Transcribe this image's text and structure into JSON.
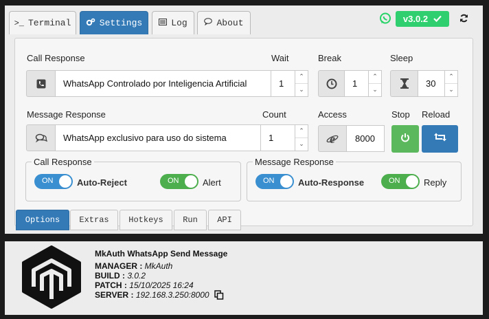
{
  "tabs": [
    {
      "label": "Terminal",
      "icon": "terminal-icon"
    },
    {
      "label": "Settings",
      "icon": "cogs-icon"
    },
    {
      "label": "Log",
      "icon": "list-icon"
    },
    {
      "label": "About",
      "icon": "comment-icon"
    }
  ],
  "header": {
    "version": "v3.0.2",
    "status_icon": "whatsapp-icon",
    "refresh_icon": "refresh-icon"
  },
  "call": {
    "label": "Call Response",
    "value": "WhatsApp Controlado por Inteligencia Artificial",
    "icon": "phone-icon"
  },
  "wait": {
    "label": "Wait",
    "value": "1"
  },
  "break": {
    "label": "Break",
    "value": "1",
    "icon": "clock-icon"
  },
  "sleep": {
    "label": "Sleep",
    "value": "30",
    "icon": "hourglass-icon"
  },
  "message": {
    "label": "Message Response",
    "value": "WhatsApp exclusivo para uso do sistema",
    "icon": "comments-icon"
  },
  "count": {
    "label": "Count",
    "value": "1"
  },
  "access": {
    "label": "Access",
    "value": "8000",
    "icon": "ie-icon"
  },
  "stop": {
    "label": "Stop",
    "icon": "power-icon"
  },
  "reload": {
    "label": "Reload",
    "icon": "retweet-icon"
  },
  "call_group": {
    "title": "Call Response",
    "toggle1": {
      "state": "ON",
      "label": "Auto-Reject"
    },
    "toggle2": {
      "state": "ON",
      "label": "Alert"
    }
  },
  "msg_group": {
    "title": "Message Response",
    "toggle1": {
      "state": "ON",
      "label": "Auto-Response"
    },
    "toggle2": {
      "state": "ON",
      "label": "Reply"
    }
  },
  "bottom_tabs": [
    "Options",
    "Extras",
    "Hotkeys",
    "Run",
    "API"
  ],
  "colors": {
    "primary": "#337ab7",
    "success": "#5cb85c",
    "whatsapp": "#25d366",
    "version_bg": "#2fcf6f"
  },
  "about": {
    "title": "MkAuth WhatsApp Send Message",
    "manager_label": "MANAGER :",
    "manager": "MkAuth",
    "build_label": "BUILD :",
    "build": "3.0.2",
    "patch_label": "PATCH :",
    "patch": "15/10/2025 16:24",
    "server_label": "SERVER :",
    "server": "192.168.3.250:8000"
  }
}
